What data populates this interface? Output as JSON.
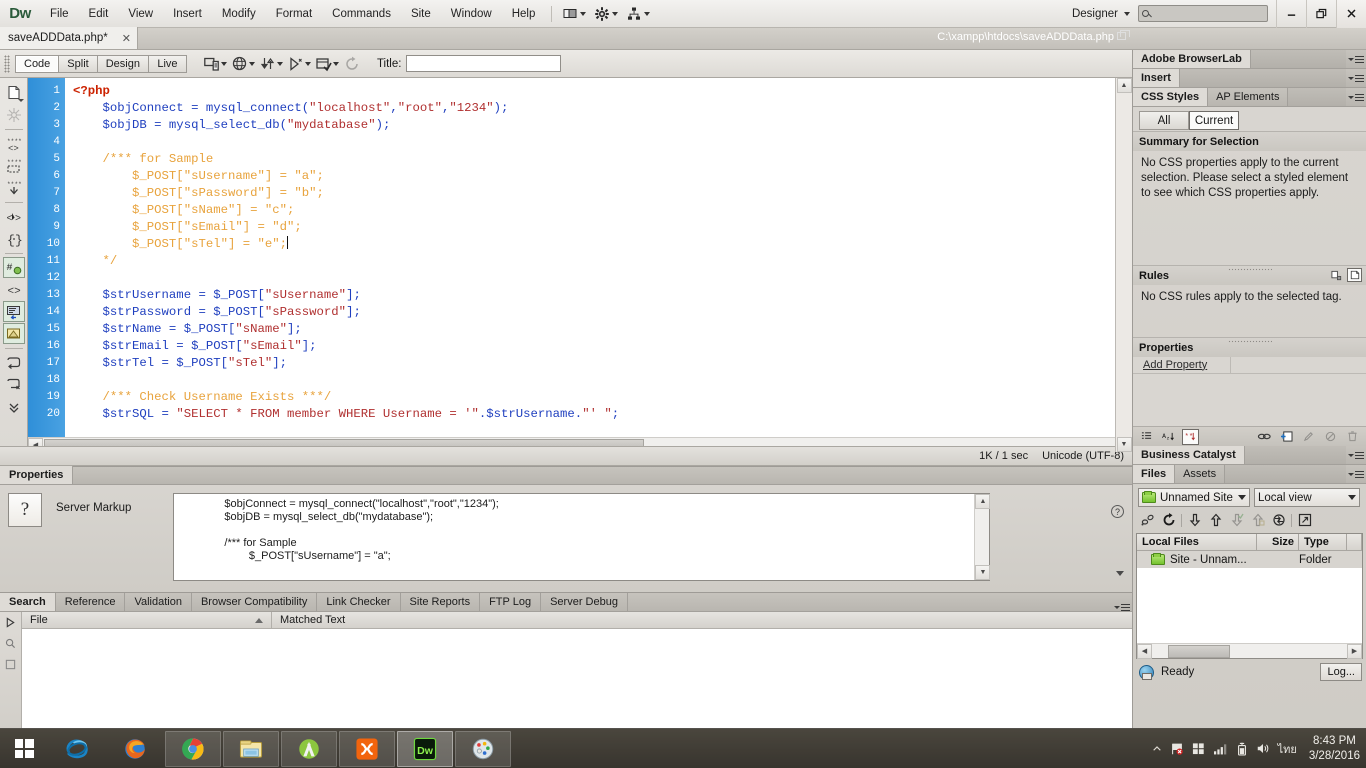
{
  "app": {
    "name": "Dreamweaver",
    "logo_text": "Dw",
    "menus": [
      "File",
      "Edit",
      "View",
      "Insert",
      "Modify",
      "Format",
      "Commands",
      "Site",
      "Window",
      "Help"
    ],
    "workspace": "Designer",
    "search_placeholder": "",
    "window_buttons": {
      "minimize": "—",
      "restore": "❐",
      "close": "✕"
    }
  },
  "document": {
    "tab_title": "saveADDData.php*",
    "tab_close": "✕",
    "file_path": "C:\\xampp\\htdocs\\saveADDData.php"
  },
  "doc_toolbar": {
    "view_modes": [
      "Code",
      "Split",
      "Design",
      "Live"
    ],
    "active_view_mode": "Code",
    "title_label": "Title:",
    "title_value": "",
    "icons": [
      "multiscreen-icon",
      "preview-in-browser-icon",
      "file-management-icon",
      "live-view-icon",
      "live-code-inspect-icon",
      "refresh-icon"
    ]
  },
  "coding_toolbar": {
    "buttons": [
      "open-documents-icon",
      "show-code-navigator-icon",
      "collapse-full-tag-icon",
      "collapse-outside-selection-icon",
      "expand-all-icon",
      "select-parent-tag-icon",
      "balance-braces-icon",
      "line-numbers-icon",
      "highlight-invalid-code-icon",
      "apply-comment-icon",
      "remove-comment-icon",
      "wrap-tag-icon",
      "recent-snippets-icon",
      "move-or-convert-css-icon",
      "more-icon"
    ]
  },
  "code_editor": {
    "line_numbers": [
      1,
      2,
      3,
      4,
      5,
      6,
      7,
      8,
      9,
      10,
      11,
      12,
      13,
      14,
      15,
      16,
      17,
      18,
      19,
      20
    ],
    "lines": [
      "<?php",
      "    $objConnect = mysql_connect(\"localhost\",\"root\",\"1234\");",
      "    $objDB = mysql_select_db(\"mydatabase\");",
      "",
      "    /*** for Sample",
      "        $_POST[\"sUsername\"] = \"a\";",
      "        $_POST[\"sPassword\"] = \"b\";",
      "        $_POST[\"sName\"] = \"c\";",
      "        $_POST[\"sEmail\"] = \"d\";",
      "        $_POST[\"sTel\"] = \"e\";",
      "    */",
      "",
      "    $strUsername = $_POST[\"sUsername\"];",
      "    $strPassword = $_POST[\"sPassword\"];",
      "    $strName = $_POST[\"sName\"];",
      "    $strEmail = $_POST[\"sEmail\"];",
      "    $strTel = $_POST[\"sTel\"];",
      "",
      "    /*** Check Username Exists ***/",
      "    $strSQL = \"SELECT * FROM member WHERE Username = '\".$strUsername.\"' \";"
    ],
    "caret_line": 10
  },
  "code_status": {
    "file_size_time": "1K / 1 sec",
    "encoding": "Unicode (UTF-8)"
  },
  "properties_panel": {
    "tab_label": "Properties",
    "icon_name": "server-markup-icon",
    "icon_glyph": "?",
    "type_label": "Server Markup",
    "code_preview": "$objConnect = mysql_connect(\"localhost\",\"root\",\"1234\");\n$objDB = mysql_select_db(\"mydatabase\");\n\n/*** for Sample\n        $_POST[\"sUsername\"] = \"a\";",
    "help_glyph": "?"
  },
  "results_panel": {
    "tabs": [
      "Search",
      "Reference",
      "Validation",
      "Browser Compatibility",
      "Link Checker",
      "Site Reports",
      "FTP Log",
      "Server Debug"
    ],
    "active_tab": "Search",
    "columns": [
      "File",
      "Matched Text"
    ],
    "rows": []
  },
  "right_dock": {
    "browserlab": {
      "title": "Adobe BrowserLab"
    },
    "insert": {
      "title": "Insert"
    },
    "css_panel": {
      "tabs": [
        "CSS Styles",
        "AP Elements"
      ],
      "active_tab": "CSS Styles",
      "mode_buttons": [
        "All",
        "Current"
      ],
      "active_mode": "Current",
      "summary_heading": "Summary for Selection",
      "summary_text": "No CSS properties apply to the current selection.  Please select a styled element to see which CSS properties apply.",
      "rules_heading": "Rules",
      "rules_text": "No CSS rules apply to the selected tag.",
      "properties_heading": "Properties",
      "add_property_label": "Add Property",
      "bottom_icons": [
        "show-category-view-icon",
        "show-list-view-icon",
        "show-only-set-properties-icon",
        "attach-style-sheet-icon",
        "new-css-rule-icon",
        "edit-rule-icon",
        "disable-css-property-icon",
        "delete-css-rule-icon"
      ]
    },
    "business_catalyst": {
      "title": "Business Catalyst"
    },
    "files_panel": {
      "tabs": [
        "Files",
        "Assets"
      ],
      "active_tab": "Files",
      "site_combo": "Unnamed Site",
      "view_combo": "Local view",
      "toolbar_icons": [
        "connect-to-remote-host-icon",
        "refresh-icon",
        "get-files-icon",
        "put-files-icon",
        "check-out-icon",
        "check-in-icon",
        "synchronize-icon",
        "expand-to-show-local-remote-icon"
      ],
      "columns": [
        "Local Files",
        "Size",
        "Type"
      ],
      "rows": [
        {
          "name": "Site - Unnam...",
          "size": "",
          "type": "Folder"
        }
      ],
      "status_text": "Ready",
      "log_button": "Log..."
    }
  },
  "taskbar": {
    "start_label": "Start",
    "apps": [
      {
        "name": "internet-explorer-icon",
        "state": "pinned"
      },
      {
        "name": "firefox-icon",
        "state": "pinned"
      },
      {
        "name": "google-chrome-icon",
        "state": "open"
      },
      {
        "name": "file-explorer-icon",
        "state": "open"
      },
      {
        "name": "android-studio-icon",
        "state": "open"
      },
      {
        "name": "xampp-control-panel-icon",
        "state": "open"
      },
      {
        "name": "dreamweaver-icon",
        "state": "active"
      },
      {
        "name": "paint-icon",
        "state": "open"
      }
    ],
    "tray_icons": [
      "show-hidden-icons-icon",
      "action-center-flag-icon",
      "windows-icon",
      "network-signal-icon",
      "battery-icon",
      "volume-icon"
    ],
    "language": "ไทย",
    "time": "8:43 PM",
    "date": "3/28/2016"
  },
  "colors": {
    "gutter_blue": "#3a95dc",
    "php_tag_red": "#cc2200",
    "variable_blue": "#1f3fbf",
    "string_red": "#b03030",
    "comment_orange": "#e8a33d",
    "chrome_gray": "#d9d6d1"
  }
}
